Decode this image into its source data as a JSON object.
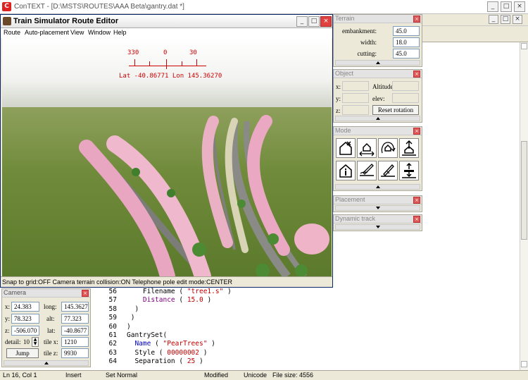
{
  "app": {
    "title": "ConTEXT - [D:\\MSTS\\ROUTES\\AAA Beta\\gantry.dat *]",
    "logo": "C",
    "window_buttons": [
      "_",
      "□",
      "×"
    ]
  },
  "route_editor": {
    "title": "Train Simulator Route Editor",
    "menu": [
      "Route",
      "Auto-placement",
      "View",
      "Window",
      "Help"
    ],
    "window_buttons": [
      "_",
      "□",
      "×"
    ],
    "compass": {
      "ticks": [
        "330",
        "0",
        "30"
      ],
      "coords": "Lat -40.86771 Lon 145.36270"
    },
    "status": "Snap to grid:OFF Camera terrain collision:ON Telephone pole edit mode:CENTER"
  },
  "terrain_panel": {
    "title": "Terrain",
    "rows": [
      {
        "label": "embankment:",
        "value": "45.0"
      },
      {
        "label": "width:",
        "value": "18.0"
      },
      {
        "label": "cutting:",
        "value": "45.0"
      }
    ]
  },
  "object_panel": {
    "title": "Object",
    "x_label": "x:",
    "y_label": "y:",
    "z_label": "z:",
    "altitude_label": "Altitude",
    "elev_label": "elev:",
    "reset_button": "Reset rotation"
  },
  "mode_panel": {
    "title": "Mode",
    "icons": [
      "delete-object-icon",
      "move-object-icon",
      "rotate-object-icon",
      "raise-object-icon",
      "info-object-icon",
      "edit-terrain-icon",
      "paint-terrain-icon",
      "level-terrain-icon"
    ]
  },
  "placement_panel": {
    "title": "Placement"
  },
  "dynamic_panel": {
    "title": "Dynamic track"
  },
  "camera_panel": {
    "title": "Camera",
    "x_label": "x:",
    "x_value": "24.383",
    "y_label": "y:",
    "y_value": "78.323",
    "z_label": "z:",
    "z_value": "-506.070",
    "long_label": "long:",
    "long_value": "145.3627",
    "alt_label": "alt:",
    "alt_value": "77.323",
    "lat_label": "lat:",
    "lat_value": "-40.8677",
    "detail_label": "detail:",
    "detail_value": "10",
    "tilex_label": "tile x:",
    "tilex_value": "1210",
    "tilez_label": "tile z:",
    "tilez_value": "9930",
    "jump_button": "Jump"
  },
  "editor": {
    "lines": [
      {
        "n": "56",
        "indent": "    ",
        "parts": [
          {
            "t": "Filename ( ",
            "c": ""
          },
          {
            "t": "\"tree1.s\"",
            "c": "str"
          },
          {
            "t": " )",
            "c": ""
          }
        ]
      },
      {
        "n": "57",
        "indent": "    ",
        "parts": [
          {
            "t": "Distance",
            "c": "prop"
          },
          {
            "t": " ( ",
            "c": ""
          },
          {
            "t": "15.0",
            "c": "num"
          },
          {
            "t": " )",
            "c": ""
          }
        ]
      },
      {
        "n": "58",
        "indent": "  ",
        "parts": [
          {
            "t": ")",
            "c": ""
          }
        ]
      },
      {
        "n": "59",
        "indent": " ",
        "parts": [
          {
            "t": ")",
            "c": ""
          }
        ]
      },
      {
        "n": "60",
        "indent": "",
        "parts": [
          {
            "t": ")",
            "c": ""
          }
        ]
      },
      {
        "n": "61",
        "indent": "",
        "parts": [
          {
            "t": "GantrySet(",
            "c": ""
          }
        ]
      },
      {
        "n": "62",
        "indent": "  ",
        "parts": [
          {
            "t": "Name",
            "c": "kw"
          },
          {
            "t": " ( ",
            "c": ""
          },
          {
            "t": "\"PearTrees\"",
            "c": "str"
          },
          {
            "t": " )",
            "c": ""
          }
        ]
      },
      {
        "n": "63",
        "indent": "  ",
        "parts": [
          {
            "t": "Style ( ",
            "c": ""
          },
          {
            "t": "00000002",
            "c": "num"
          },
          {
            "t": " )",
            "c": ""
          }
        ]
      },
      {
        "n": "64",
        "indent": "  ",
        "parts": [
          {
            "t": "Separation ( ",
            "c": ""
          },
          {
            "t": "25",
            "c": "num"
          },
          {
            "t": " )",
            "c": ""
          }
        ]
      }
    ]
  },
  "statusbar": {
    "position": "Ln 16, Col 1",
    "mode": "Insert",
    "set": "Set Normal",
    "modified": "Modified",
    "encoding": "Unicode",
    "filesize": "File size: 4556"
  }
}
